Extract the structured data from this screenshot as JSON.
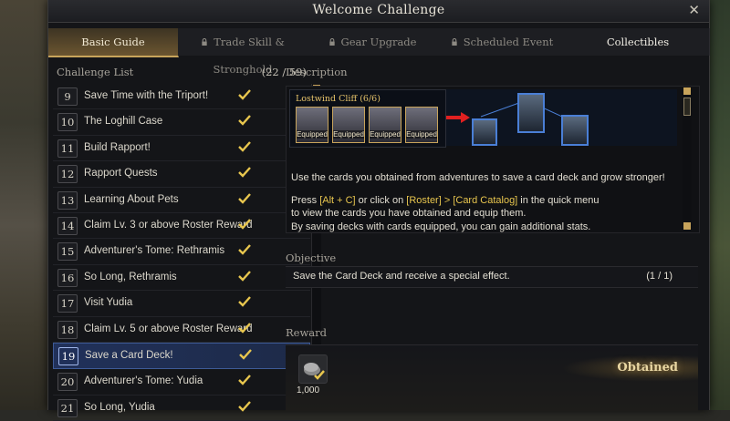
{
  "window": {
    "title": "Welcome Challenge"
  },
  "tabs": [
    {
      "label": "Basic Guide",
      "locked": false,
      "active": true
    },
    {
      "label": "Trade Skill & Stronghold",
      "locked": true,
      "active": false
    },
    {
      "label": "Gear Upgrade",
      "locked": true,
      "active": false
    },
    {
      "label": "Scheduled Event",
      "locked": true,
      "active": false
    },
    {
      "label": "Collectibles",
      "locked": false,
      "active": false
    }
  ],
  "challenge_list": {
    "header": "Challenge List",
    "count": "(22 / 59)",
    "items": [
      {
        "num": "9",
        "label": "Save Time with the Triport!"
      },
      {
        "num": "10",
        "label": "The Loghill Case"
      },
      {
        "num": "11",
        "label": "Build Rapport!"
      },
      {
        "num": "12",
        "label": "Rapport Quests"
      },
      {
        "num": "13",
        "label": "Learning About Pets"
      },
      {
        "num": "14",
        "label": "Claim Lv. 3 or above Roster Reward"
      },
      {
        "num": "15",
        "label": "Adventurer's Tome: Rethramis"
      },
      {
        "num": "16",
        "label": "So Long, Rethramis"
      },
      {
        "num": "17",
        "label": "Visit Yudia"
      },
      {
        "num": "18",
        "label": "Claim Lv. 5 or above Roster Reward"
      },
      {
        "num": "19",
        "label": "Save a Card Deck!"
      },
      {
        "num": "20",
        "label": "Adventurer's Tome: Yudia"
      },
      {
        "num": "21",
        "label": "So Long, Yudia"
      }
    ]
  },
  "description": {
    "header": "Description",
    "card_set_label": "Lostwind Cliff (6/6)",
    "card_badge": "Equipped",
    "line1": "Use the cards you obtained from adventures to save a card deck and grow stronger!",
    "line2_a": "Press ",
    "line2_key": "[Alt + C]",
    "line2_b": " or click on ",
    "line2_path": "[Roster] > [Card Catalog]",
    "line2_c": " in the quick menu",
    "line3": "to view the cards you have obtained and equip them.",
    "line4": "By saving decks with cards equipped, you can gain additional stats."
  },
  "objective": {
    "header": "Objective",
    "text": "Save the Card Deck and receive a special effect.",
    "progress": "(1 / 1)"
  },
  "reward": {
    "header": "Reward",
    "quantity": "1,000",
    "status": "Obtained"
  },
  "colors": {
    "accent": "#c8a45b",
    "highlight": "#e8c64e",
    "selected": "#2a3d6b",
    "check": "#e8c64e"
  }
}
